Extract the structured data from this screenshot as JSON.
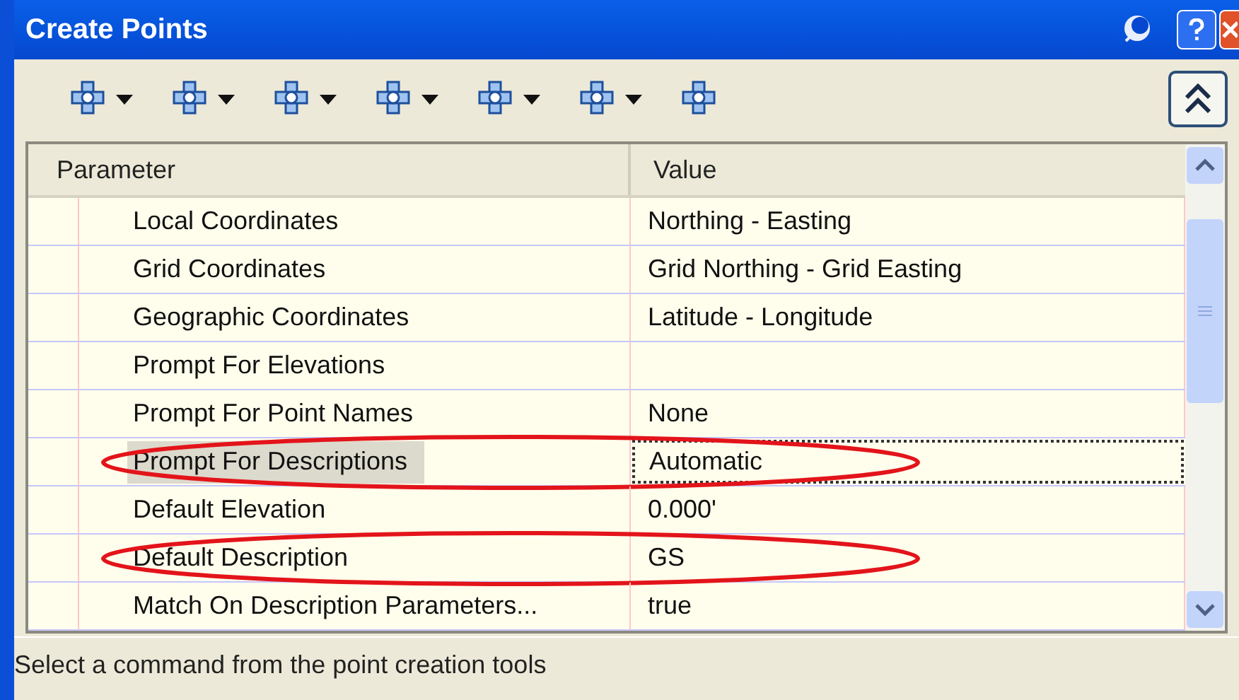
{
  "window": {
    "title": "Create Points"
  },
  "toolbar": [
    {
      "kind": "dropdown"
    },
    {
      "kind": "dropdown"
    },
    {
      "kind": "dropdown"
    },
    {
      "kind": "dropdown"
    },
    {
      "kind": "dropdown"
    },
    {
      "kind": "dropdown"
    },
    {
      "kind": "plain"
    }
  ],
  "table": {
    "columns": [
      "Parameter",
      "Value"
    ],
    "rows": [
      {
        "parameter": "Local Coordinates",
        "value": "Northing - Easting",
        "selected": false,
        "circled": false
      },
      {
        "parameter": "Grid Coordinates",
        "value": "Grid Northing - Grid Easting",
        "selected": false,
        "circled": false
      },
      {
        "parameter": "Geographic Coordinates",
        "value": "Latitude - Longitude",
        "selected": false,
        "circled": false
      },
      {
        "parameter": "Prompt For Elevations",
        "value": "",
        "selected": false,
        "circled": false
      },
      {
        "parameter": "Prompt For Point Names",
        "value": "None",
        "selected": false,
        "circled": false
      },
      {
        "parameter": "Prompt For Descriptions",
        "value": "Automatic",
        "selected": true,
        "circled": true
      },
      {
        "parameter": "Default Elevation",
        "value": "0.000'",
        "selected": false,
        "circled": false
      },
      {
        "parameter": "Default Description",
        "value": "GS",
        "selected": false,
        "circled": true
      },
      {
        "parameter": "Match On Description Parameters...",
        "value": "true",
        "selected": false,
        "circled": false
      }
    ]
  },
  "status_bar": "Select a command from the point creation tools"
}
